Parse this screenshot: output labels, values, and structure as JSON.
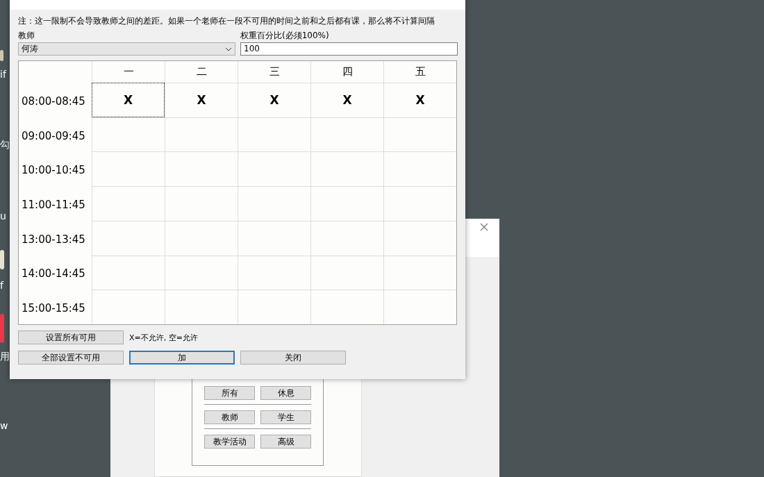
{
  "desktop": {
    "labels": [
      "if",
      "勾",
      "u",
      "f",
      "用",
      "w"
    ]
  },
  "back_window": {
    "groups": [
      [
        "所有",
        "休息"
      ],
      [
        "教师",
        "学生"
      ],
      [
        "教学活动",
        "高级"
      ]
    ]
  },
  "dialog": {
    "note": "注：这一限制不会导致教师之间的差距。如果一个老师在一段不可用的时间之前和之后都有课，那么将不计算间隔",
    "teacher_label": "教师",
    "teacher_value": "何涛",
    "weight_label": "权重百分比(必须100%)",
    "weight_value": "100",
    "table": {
      "columns": [
        "一",
        "二",
        "三",
        "四",
        "五"
      ],
      "rows": [
        {
          "time": "08:00-08:45",
          "cells": [
            {
              "value": "X",
              "focused": true
            },
            {
              "value": "X",
              "focused": false
            },
            {
              "value": "X",
              "focused": false
            },
            {
              "value": "X",
              "focused": false
            },
            {
              "value": "X",
              "focused": false
            }
          ]
        },
        {
          "time": "09:00-09:45",
          "cells": [
            {
              "focused": false
            },
            {
              "focused": false
            },
            {
              "focused": false
            },
            {
              "focused": false
            },
            {
              "focused": false
            }
          ]
        },
        {
          "time": "10:00-10:45",
          "cells": [
            {
              "focused": false
            },
            {
              "focused": false
            },
            {
              "focused": false
            },
            {
              "focused": false
            },
            {
              "focused": false
            }
          ]
        },
        {
          "time": "11:00-11:45",
          "cells": [
            {
              "focused": false
            },
            {
              "focused": false
            },
            {
              "focused": false
            },
            {
              "focused": false
            },
            {
              "focused": false
            }
          ]
        },
        {
          "time": "13:00-13:45",
          "cells": [
            {
              "focused": false
            },
            {
              "focused": false
            },
            {
              "focused": false
            },
            {
              "focused": false
            },
            {
              "focused": false
            }
          ]
        },
        {
          "time": "14:00-14:45",
          "cells": [
            {
              "focused": false
            },
            {
              "focused": false
            },
            {
              "focused": false
            },
            {
              "focused": false
            },
            {
              "focused": false
            }
          ]
        },
        {
          "time": "15:00-15:45",
          "cells": [
            {
              "focused": false
            },
            {
              "focused": false
            },
            {
              "focused": false
            },
            {
              "focused": false
            },
            {
              "focused": false
            }
          ]
        }
      ]
    },
    "set_all_available": "设置所有可用",
    "legend": "X=不允许, 空=允许",
    "buttons": [
      {
        "label": "全部设置不可用",
        "default": false
      },
      {
        "label": "加",
        "default": true
      },
      {
        "label": "关闭",
        "default": false
      }
    ]
  }
}
